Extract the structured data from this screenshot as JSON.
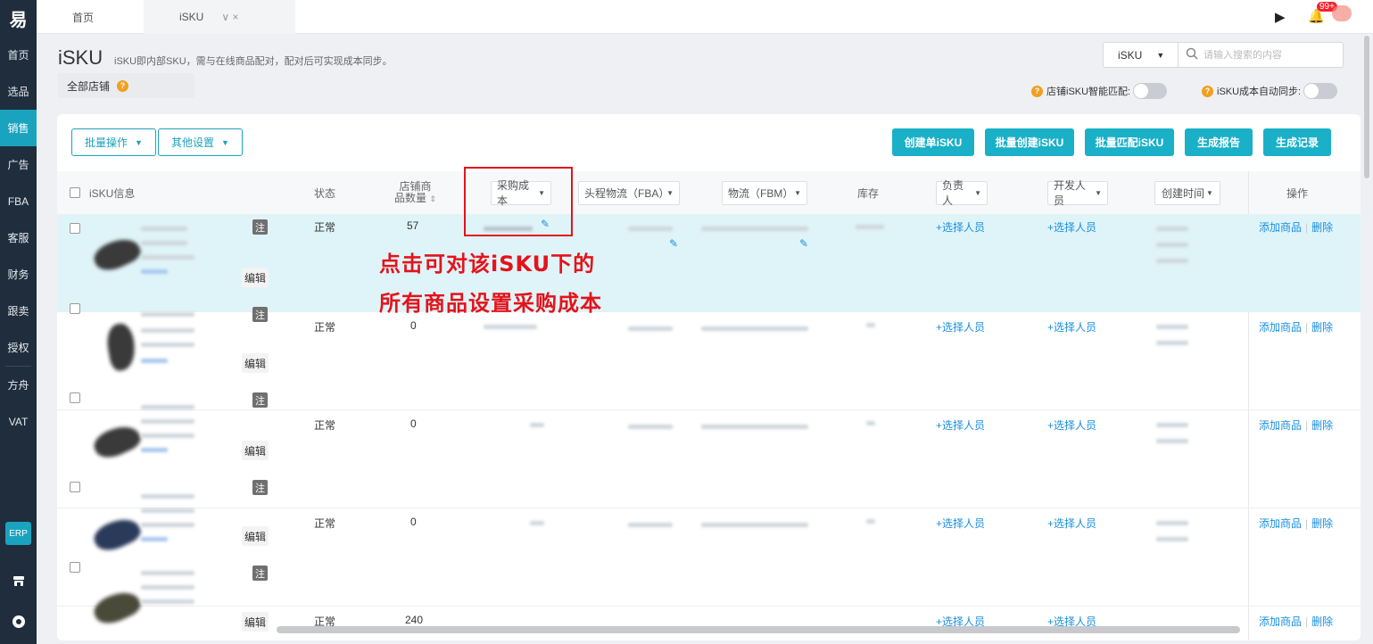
{
  "sidebar": {
    "logo": "易",
    "items": [
      {
        "label": "首页",
        "active": false
      },
      {
        "label": "选品",
        "active": false
      },
      {
        "label": "销售",
        "active": true
      },
      {
        "label": "广告",
        "active": false
      },
      {
        "label": "FBA",
        "active": false
      },
      {
        "label": "客服",
        "active": false
      },
      {
        "label": "财务",
        "active": false
      },
      {
        "label": "跟卖",
        "active": false
      },
      {
        "label": "授权",
        "active": false
      },
      {
        "label": "方舟",
        "active": false
      },
      {
        "label": "VAT",
        "active": false
      }
    ],
    "erp_label": "ERP",
    "bottom_icons": [
      "store-icon",
      "help-circle-icon"
    ]
  },
  "topbar": {
    "tab_home": "首页",
    "tab_isku": "iSKU",
    "tab_controls": "∨ ×",
    "notification_badge": "99+"
  },
  "header": {
    "title": "iSKU",
    "description": "iSKU即内部SKU，需与在线商品配对，配对后可实现成本同步。",
    "store_filter": "全部店铺",
    "search_select": "iSKU",
    "search_placeholder": "请输入搜索的内容",
    "toggle_match_label": "店铺iSKU智能匹配:",
    "toggle_sync_label": "iSKU成本自动同步:"
  },
  "toolbar": {
    "batch_ops": "批量操作",
    "other_settings": "其他设置",
    "create_single": "创建单iSKU",
    "batch_create": "批量创建iSKU",
    "batch_match": "批量匹配iSKU",
    "gen_report": "生成报告",
    "gen_record": "生成记录"
  },
  "table": {
    "headers": {
      "info": "iSKU信息",
      "status": "状态",
      "store_count_l1": "店铺商",
      "store_count_l2": "品数量",
      "purchase_cost": "采购成本",
      "fba_logistics": "头程物流（FBA）",
      "fbm_logistics": "物流（FBM）",
      "stock": "库存",
      "owner": "负责人",
      "developer": "开发人员",
      "created_at": "创建时间",
      "actions": "操作"
    },
    "tag_zhu": "注",
    "tag_edit": "编辑",
    "select_person": "+选择人员",
    "add_product": "添加商品",
    "delete": "删除",
    "rows": [
      {
        "status": "正常",
        "store_count": "57"
      },
      {
        "status": "正常",
        "store_count": "0"
      },
      {
        "status": "正常",
        "store_count": "0"
      },
      {
        "status": "正常",
        "store_count": "0"
      },
      {
        "status": "正常",
        "store_count": "240"
      }
    ]
  },
  "annotation": {
    "line1": "点击可对该iSKU下的",
    "line2": "所有商品设置采购成本"
  },
  "colors": {
    "accent": "#1aa3be",
    "sidebar_bg": "#1f2d3d",
    "annotation": "#e4131b",
    "highlight_row": "#dff4f8"
  }
}
